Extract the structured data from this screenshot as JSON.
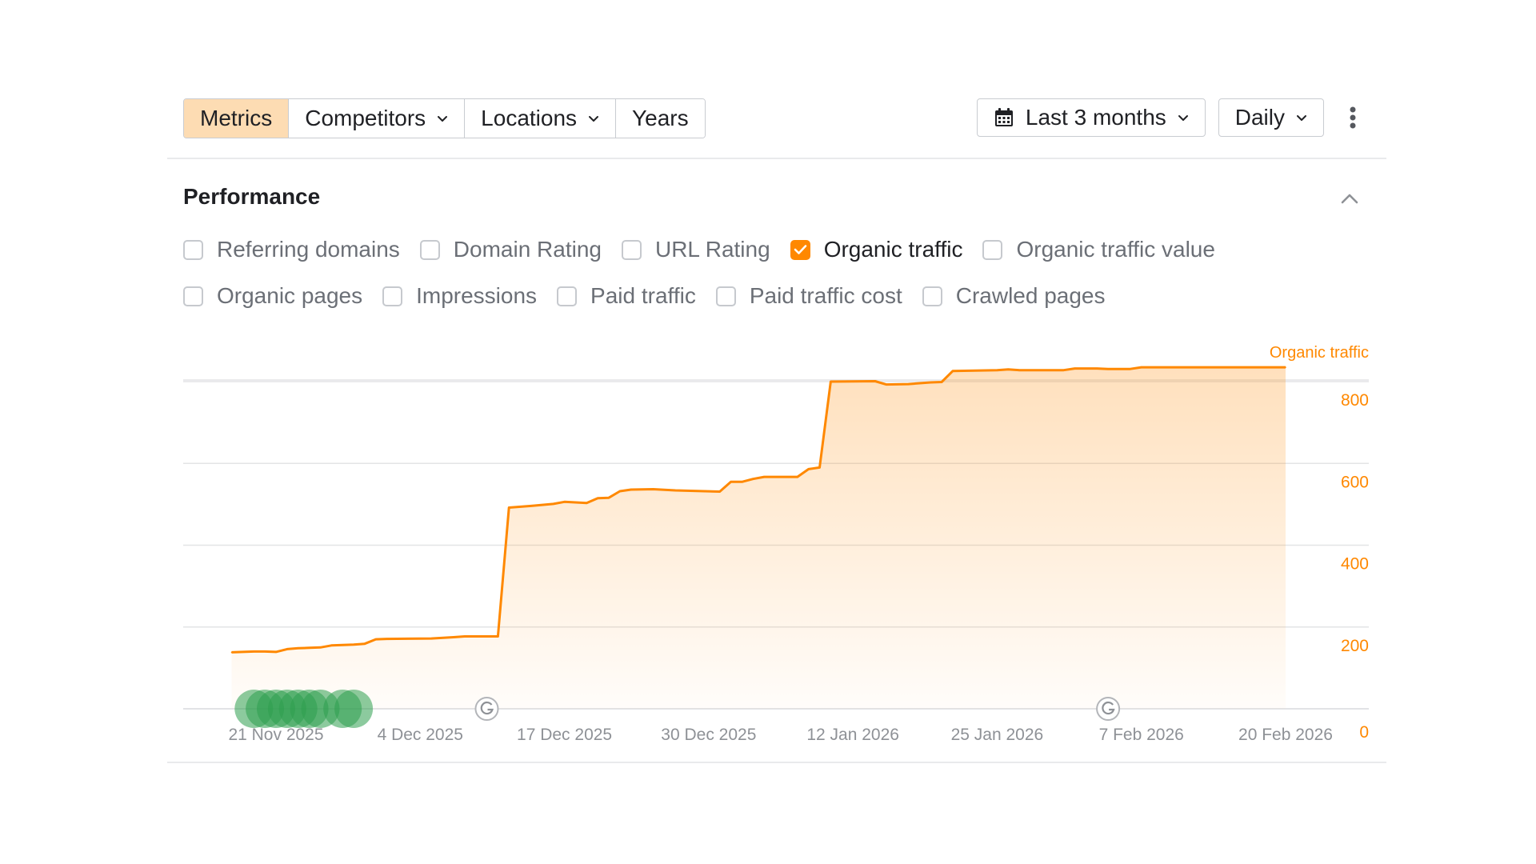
{
  "toolbar": {
    "tabs": [
      {
        "label": "Metrics",
        "active": true,
        "dropdown": false
      },
      {
        "label": "Competitors",
        "active": false,
        "dropdown": true
      },
      {
        "label": "Locations",
        "active": false,
        "dropdown": true
      },
      {
        "label": "Years",
        "active": false,
        "dropdown": false
      }
    ],
    "date_range": "Last 3 months",
    "interval": "Daily",
    "icons": {
      "calendar": "calendar-icon",
      "more": "more-vertical-icon",
      "chevron": "chevron-down-icon"
    }
  },
  "section": {
    "title": "Performance",
    "metrics_row1": [
      {
        "label": "Referring domains",
        "checked": false
      },
      {
        "label": "Domain Rating",
        "checked": false
      },
      {
        "label": "URL Rating",
        "checked": false
      },
      {
        "label": "Organic traffic",
        "checked": true
      },
      {
        "label": "Organic traffic value",
        "checked": false
      }
    ],
    "metrics_row2": [
      {
        "label": "Organic pages",
        "checked": false
      },
      {
        "label": "Impressions",
        "checked": false
      },
      {
        "label": "Paid traffic",
        "checked": false
      },
      {
        "label": "Paid traffic cost",
        "checked": false
      },
      {
        "label": "Crawled pages",
        "checked": false
      }
    ]
  },
  "colors": {
    "accent": "#ff8800",
    "active_tab": "#fddcb3",
    "event_marker": "#2e9e4f",
    "grid": "#e3e4e6",
    "axis_text": "#8e9196"
  },
  "chart_data": {
    "type": "area",
    "series": [
      {
        "name": "Organic traffic",
        "color": "#ff8800",
        "points": [
          [
            "2025-11-17",
            138
          ],
          [
            "2025-11-18",
            139
          ],
          [
            "2025-11-19",
            140
          ],
          [
            "2025-11-20",
            140
          ],
          [
            "2025-11-21",
            139
          ],
          [
            "2025-11-22",
            146
          ],
          [
            "2025-11-23",
            148
          ],
          [
            "2025-11-24",
            149
          ],
          [
            "2025-11-25",
            150
          ],
          [
            "2025-11-26",
            155
          ],
          [
            "2025-11-27",
            156
          ],
          [
            "2025-11-28",
            157
          ],
          [
            "2025-11-29",
            159
          ],
          [
            "2025-11-30",
            170
          ],
          [
            "2025-12-01",
            171
          ],
          [
            "2025-12-05",
            172
          ],
          [
            "2025-12-07",
            175
          ],
          [
            "2025-12-08",
            177
          ],
          [
            "2025-12-11",
            177
          ],
          [
            "2025-12-12",
            492
          ],
          [
            "2025-12-14",
            496
          ],
          [
            "2025-12-16",
            501
          ],
          [
            "2025-12-17",
            506
          ],
          [
            "2025-12-19",
            503
          ],
          [
            "2025-12-20",
            515
          ],
          [
            "2025-12-21",
            516
          ],
          [
            "2025-12-22",
            532
          ],
          [
            "2025-12-23",
            536
          ],
          [
            "2025-12-25",
            537
          ],
          [
            "2025-12-27",
            534
          ],
          [
            "2025-12-31",
            531
          ],
          [
            "2026-01-01",
            555
          ],
          [
            "2026-01-02",
            555
          ],
          [
            "2026-01-03",
            562
          ],
          [
            "2026-01-04",
            567
          ],
          [
            "2026-01-07",
            567
          ],
          [
            "2026-01-08",
            586
          ],
          [
            "2026-01-09",
            590
          ],
          [
            "2026-01-10",
            800
          ],
          [
            "2026-01-14",
            801
          ],
          [
            "2026-01-15",
            793
          ],
          [
            "2026-01-17",
            794
          ],
          [
            "2026-01-19",
            798
          ],
          [
            "2026-01-20",
            799
          ],
          [
            "2026-01-21",
            826
          ],
          [
            "2026-01-23",
            827
          ],
          [
            "2026-01-25",
            828
          ],
          [
            "2026-01-26",
            830
          ],
          [
            "2026-01-27",
            828
          ],
          [
            "2026-01-31",
            828
          ],
          [
            "2026-02-01",
            832
          ],
          [
            "2026-02-03",
            832
          ],
          [
            "2026-02-04",
            831
          ],
          [
            "2026-02-06",
            831
          ],
          [
            "2026-02-07",
            835
          ],
          [
            "2026-02-20",
            835
          ]
        ]
      }
    ],
    "x_ticks": [
      "21 Nov 2025",
      "4 Dec 2025",
      "17 Dec 2025",
      "30 Dec 2025",
      "12 Jan 2026",
      "25 Jan 2026",
      "7 Feb 2026",
      "20 Feb 2026"
    ],
    "y_ticks": [
      "800",
      "600",
      "400",
      "200",
      "0"
    ],
    "y_axis_label": "Organic traffic",
    "ylim": [
      0,
      800
    ],
    "grid": true,
    "legend": "none",
    "annotations": {
      "google_updates": [
        "2025-12-10",
        "2026-02-04"
      ],
      "google_update_icon": "google-g-icon",
      "event_markers": [
        "2025-11-19",
        "2025-11-20",
        "2025-11-21",
        "2025-11-22",
        "2025-11-23",
        "2025-11-24",
        "2025-11-25",
        "2025-11-27",
        "2025-11-28"
      ]
    }
  }
}
